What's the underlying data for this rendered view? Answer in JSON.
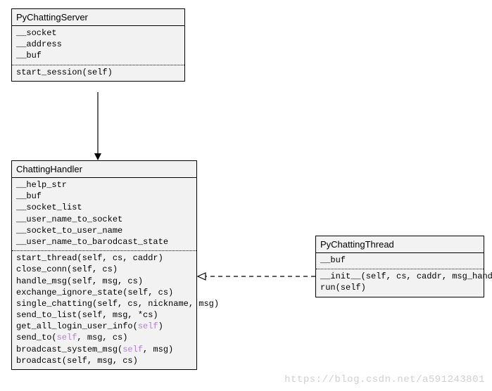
{
  "classes": {
    "server": {
      "name": "PyChattingServer",
      "attrs": [
        "__socket",
        "__address",
        "__buf"
      ],
      "methods": [
        "start_session(self)"
      ]
    },
    "handler": {
      "name": "ChattingHandler",
      "attrs": [
        "__help_str",
        "__buf",
        "__socket_list",
        "__user_name_to_socket",
        "__socket_to_user_name",
        "__user_name_to_barodcast_state"
      ],
      "methods_plain": [
        "start_thread(self, cs, caddr)",
        "close_conn(self, cs)",
        "handle_msg(self, msg, cs)",
        "exchange_ignore_state(self, cs)",
        "single_chatting(self, cs, nickname, msg)",
        "send_to_list(self, msg, *cs)"
      ],
      "m_get_all_pre": "get_all_login_user_info(",
      "m_get_all_self": "self",
      "m_get_all_post": ")",
      "m_send_to_pre": "send_to(",
      "m_send_to_self": "self",
      "m_send_to_post": ", msg, cs)",
      "m_bcast_sys_pre": "broadcast_system_msg(",
      "m_bcast_sys_self": "self",
      "m_bcast_sys_post": ", msg)",
      "m_bcast": "broadcast(self, msg, cs)"
    },
    "thread": {
      "name": "PyChattingThread",
      "attrs": [
        "__buf"
      ],
      "methods": [
        "__init__(self, cs, caddr, msg_handler)",
        "run(self)"
      ]
    }
  },
  "watermark": "https://blog.csdn.net/a591243801"
}
